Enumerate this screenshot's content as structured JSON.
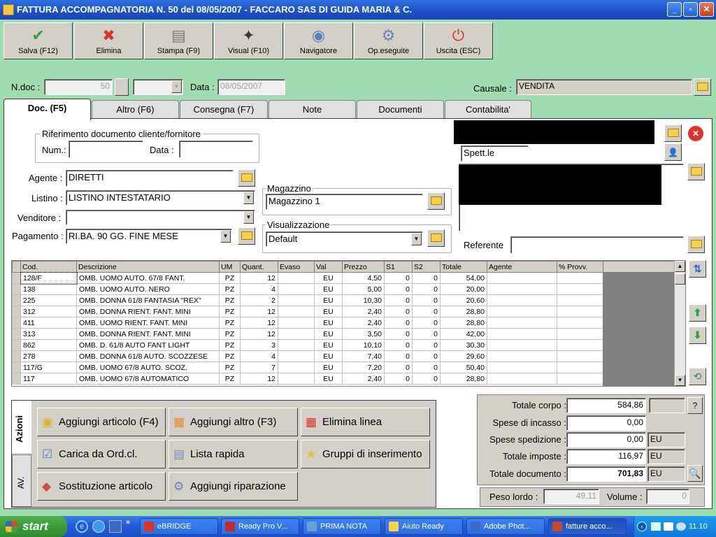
{
  "window": {
    "title": "FATTURA ACCOMPAGNATORIA N. 50  del 08/05/2007 - FACCARO SAS DI GUIDA MARIA & C."
  },
  "toolbar": [
    {
      "label": "Salva (F12)",
      "icon": "check-icon",
      "color": "#2ea043"
    },
    {
      "label": "Elimina",
      "icon": "x-icon",
      "color": "#d9342b"
    },
    {
      "label": "Stampa (F9)",
      "icon": "printer-icon",
      "color": "#7a7a7a"
    },
    {
      "label": "Visual (F10)",
      "icon": "magic-wand-icon",
      "color": "#3a3a3a"
    },
    {
      "label": "Navigatore",
      "icon": "compass-icon",
      "color": "#5a7fc0"
    },
    {
      "label": "Op.eseguite",
      "icon": "gears-icon",
      "color": "#6a7fc0"
    },
    {
      "label": "Uscita (ESC)",
      "icon": "power-icon",
      "color": "#d9342b"
    }
  ],
  "header": {
    "ndoc_label": "N.doc :",
    "ndoc_value": "50",
    "data_label": "Data :",
    "data_value": "08/05/2007",
    "causale_label": "Causale :",
    "causale_value": "VENDITA"
  },
  "tabs": [
    "Doc. (F5)",
    "Altro (F6)",
    "Consegna (F7)",
    "Note",
    "Documenti",
    "Contabilita'"
  ],
  "riferimento": {
    "legend": "Riferimento documento cliente/fornitore",
    "num_label": "Num.:",
    "num_value": "",
    "data_label": "Data :",
    "data_value": ""
  },
  "form": {
    "agente_label": "Agente :",
    "agente_value": "DIRETTI",
    "listino_label": "Listino :",
    "listino_value": "LISTINO INTESTATARIO",
    "venditore_label": "Venditore :",
    "venditore_value": "",
    "pagamento_label": "Pagamento :",
    "pagamento_value": "RI.BA. 90 GG. FINE MESE"
  },
  "magazzino": {
    "legend": "Magazzino",
    "value": "Magazzino 1"
  },
  "visualizzazione": {
    "legend": "Visualizzazione",
    "value": "Default"
  },
  "cliente": {
    "spett_value": "Spett.le",
    "referente_label": "Referente",
    "referente_value": ""
  },
  "grid": {
    "columns": [
      "Cod.",
      "Descrizione",
      "UM",
      "Quant.",
      "Evaso",
      "Val",
      "Prezzo",
      "S1",
      "S2",
      "Totale",
      "Agente",
      "% Provv."
    ],
    "rows": [
      [
        "128/F",
        "OMB. UOMO AUTO. 67/8 FANT.",
        "PZ",
        "12",
        "",
        "EU",
        "4,50",
        "0",
        "0",
        "54,00",
        "",
        ""
      ],
      [
        "138",
        "OMB. UOMO AUTO. NERO",
        "PZ",
        "4",
        "",
        "EU",
        "5,00",
        "0",
        "0",
        "20,00",
        "",
        ""
      ],
      [
        "225",
        "OMB. DONNA 61/8 FANTASIA \"REX\"",
        "PZ",
        "2",
        "",
        "EU",
        "10,30",
        "0",
        "0",
        "20,60",
        "",
        ""
      ],
      [
        "312",
        "OMB. DONNA RIENT. FANT. MINI",
        "PZ",
        "12",
        "",
        "EU",
        "2,40",
        "0",
        "0",
        "28,80",
        "",
        ""
      ],
      [
        "411",
        "OMB. UOMO RIENT. FANT. MINI",
        "PZ",
        "12",
        "",
        "EU",
        "2,40",
        "0",
        "0",
        "28,80",
        "",
        ""
      ],
      [
        "313",
        "OMB. DONNA RIENT. FANT. MINI",
        "PZ",
        "12",
        "",
        "EU",
        "3,50",
        "0",
        "0",
        "42,00",
        "",
        ""
      ],
      [
        "862",
        "OMB. D. 61/8 AUTO FANT LIGHT",
        "PZ",
        "3",
        "",
        "EU",
        "10,10",
        "0",
        "0",
        "30,30",
        "",
        ""
      ],
      [
        "278",
        "OMB. DONNA 61/8 AUTO. SCOZZESE",
        "PZ",
        "4",
        "",
        "EU",
        "7,40",
        "0",
        "0",
        "29,60",
        "",
        ""
      ],
      [
        "117/G",
        "OMB. UOMO 67/8 AUTO. SCOZ.",
        "PZ",
        "7",
        "",
        "EU",
        "7,20",
        "0",
        "0",
        "50,40",
        "",
        ""
      ],
      [
        "117",
        "OMB. UOMO 67/8 AUTOMATICO",
        "PZ",
        "12",
        "",
        "EU",
        "2,40",
        "0",
        "0",
        "28,80",
        "",
        ""
      ]
    ]
  },
  "actions": {
    "side_tabs": [
      "Azioni",
      "AV."
    ],
    "buttons": [
      {
        "label": "Aggiungi articolo (F4)",
        "icon": "box-add-icon",
        "color": "#e0b030"
      },
      {
        "label": "Aggiungi altro (F3)",
        "icon": "grid-add-icon",
        "color": "#e08a30"
      },
      {
        "label": "Elimina linea",
        "icon": "grid-delete-icon",
        "color": "#d9342b"
      },
      {
        "label": "Carica da Ord.cl.",
        "icon": "list-check-icon",
        "color": "#4a7fd0"
      },
      {
        "label": "Lista rapida",
        "icon": "search-list-icon",
        "color": "#6a8fc0"
      },
      {
        "label": "Gruppi di inserimento",
        "icon": "star-icon",
        "color": "#e8c020"
      },
      {
        "label": "Sostituzione articolo",
        "icon": "shapes-icon",
        "color": "#d04a4a"
      },
      {
        "label": "Aggiungi riparazione",
        "icon": "gear-icon",
        "color": "#6a7fc0"
      }
    ]
  },
  "totals": {
    "corpo_label": "Totale corpo :",
    "corpo_value": "584,86",
    "corpo_btn": "?",
    "incasso_label": "Spese di incasso :",
    "incasso_value": "0,00",
    "spedizione_label": "Spese spedizione :",
    "spedizione_value": "0,00",
    "spedizione_cur": "EU",
    "imposte_label": "Totale imposte :",
    "imposte_value": "116,97",
    "imposte_cur": "EU",
    "documento_label": "Totale documento :",
    "documento_value": "701,83",
    "documento_cur": "EU",
    "peso_label": "Peso lordo :",
    "peso_value": "49,11",
    "volume_label": "Volume :",
    "volume_value": "0"
  },
  "taskbar": {
    "start_label": "start",
    "tasks": [
      {
        "label": "eBRIDGE",
        "color": "#d9342b"
      },
      {
        "label": "Ready Pro V...",
        "color": "#c02a2a"
      },
      {
        "label": "PRIMA NOTA",
        "color": "#6aa0d8"
      },
      {
        "label": "Aiuto Ready",
        "color": "#f4d24a"
      },
      {
        "label": "Adobe Phot...",
        "color": "#3a6ac0"
      },
      {
        "label": "fatture acco...",
        "color": "#c04a30"
      }
    ],
    "clock": "11.10"
  }
}
